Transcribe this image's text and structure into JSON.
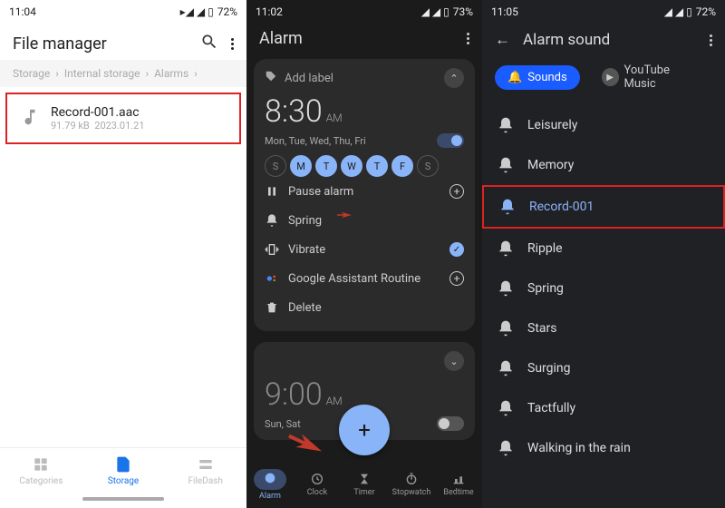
{
  "p1": {
    "status": {
      "time": "11:04",
      "battery": "72%"
    },
    "title": "File manager",
    "crumbs": [
      "Storage",
      "Internal storage",
      "Alarms"
    ],
    "file": {
      "name": "Record-001.aac",
      "size": "91.79 kB",
      "date": "2023.01.21"
    },
    "nav": {
      "categories": "Categories",
      "storage": "Storage",
      "filedash": "FileDash"
    }
  },
  "p2": {
    "status": {
      "time": "11:02",
      "battery": "73%"
    },
    "title": "Alarm",
    "alarm1": {
      "add_label": "Add label",
      "time": "8:30",
      "ampm": "AM",
      "days_text": "Mon, Tue, Wed, Thu, Fri",
      "days": [
        "S",
        "M",
        "T",
        "W",
        "T",
        "F",
        "S"
      ],
      "days_on": [
        false,
        true,
        true,
        true,
        true,
        true,
        false
      ],
      "opts": {
        "pause": "Pause alarm",
        "sound": "Spring",
        "vibrate": "Vibrate",
        "assistant": "Google Assistant Routine",
        "delete": "Delete"
      }
    },
    "alarm2": {
      "time": "9:00",
      "ampm": "AM",
      "days_text": "Sun, Sat"
    },
    "bnav": {
      "alarm": "Alarm",
      "clock": "Clock",
      "timer": "Timer",
      "stopwatch": "Stopwatch",
      "bedtime": "Bedtime"
    }
  },
  "p3": {
    "status": {
      "time": "11:05",
      "battery": "72%"
    },
    "title": "Alarm sound",
    "chips": {
      "sounds": "Sounds",
      "yt": "YouTube Music"
    },
    "sounds": [
      "Leisurely",
      "Memory",
      "Record-001",
      "Ripple",
      "Spring",
      "Stars",
      "Surging",
      "Tactfully",
      "Walking in the rain"
    ],
    "selected": "Record-001"
  }
}
